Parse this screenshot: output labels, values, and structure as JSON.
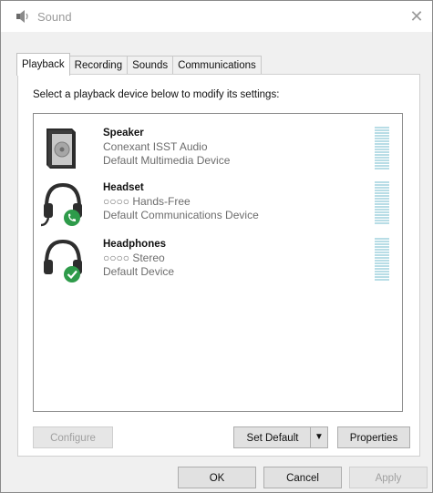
{
  "window": {
    "title": "Sound",
    "close_label": "✕"
  },
  "tabs": [
    {
      "label": "Playback",
      "active": true
    },
    {
      "label": "Recording",
      "active": false
    },
    {
      "label": "Sounds",
      "active": false
    },
    {
      "label": "Communications",
      "active": false
    }
  ],
  "instruction": "Select a playback device below to modify its settings:",
  "devices": [
    {
      "name": "Speaker",
      "line2": "Conexant ISST Audio",
      "line3": "Default Multimedia Device",
      "icon": "speaker-icon",
      "badge": "none"
    },
    {
      "name": "Headset",
      "line2": "○○○○ Hands-Free",
      "line3": "Default Communications Device",
      "icon": "headset-icon",
      "badge": "phone-badge-icon"
    },
    {
      "name": "Headphones",
      "line2": "○○○○ Stereo",
      "line3": "Default Device",
      "icon": "headphones-icon",
      "badge": "check-badge-icon"
    }
  ],
  "buttons": {
    "configure": "Configure",
    "set_default": "Set Default",
    "set_default_arrow": "▼",
    "properties": "Properties",
    "ok": "OK",
    "cancel": "Cancel",
    "apply": "Apply"
  },
  "colors": {
    "badge_green": "#2e9b4a",
    "meter_blue": "#b8dde6",
    "dialog_bg": "#f0f0f0"
  }
}
